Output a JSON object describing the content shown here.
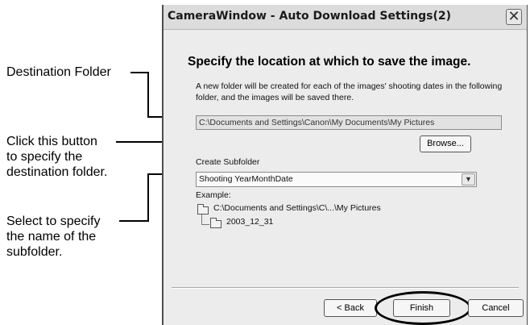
{
  "window": {
    "title": "CameraWindow - Auto Download Settings(2)",
    "close_glyph": "✕",
    "heading": "Specify the location at which to save the image.",
    "description": "A new folder will be created for each of the images' shooting dates in the following folder, and the images will be saved there.",
    "destination_path": "C:\\Documents and Settings\\Canon\\My Documents\\My Pictures",
    "browse_label": "Browse...",
    "subfolder_label": "Create Subfolder",
    "subfolder_value": "Shooting YearMonthDate",
    "example_label": "Example:",
    "example_path": "C:\\Documents and Settings\\C\\...\\My Pictures",
    "example_subfolder": "2003_12_31",
    "back_label": "< Back",
    "finish_label": "Finish",
    "cancel_label": "Cancel"
  },
  "callouts": {
    "destination_folder": "Destination Folder",
    "browse_hint_1": "Click this button",
    "browse_hint_2": "to specify the",
    "browse_hint_3": "destination folder.",
    "subfolder_hint_1": "Select to specify",
    "subfolder_hint_2": "the name of the",
    "subfolder_hint_3": "subfolder."
  },
  "icons": {
    "close": "close-icon",
    "dropdown": "chevron-down-icon",
    "folder": "folder-icon"
  }
}
